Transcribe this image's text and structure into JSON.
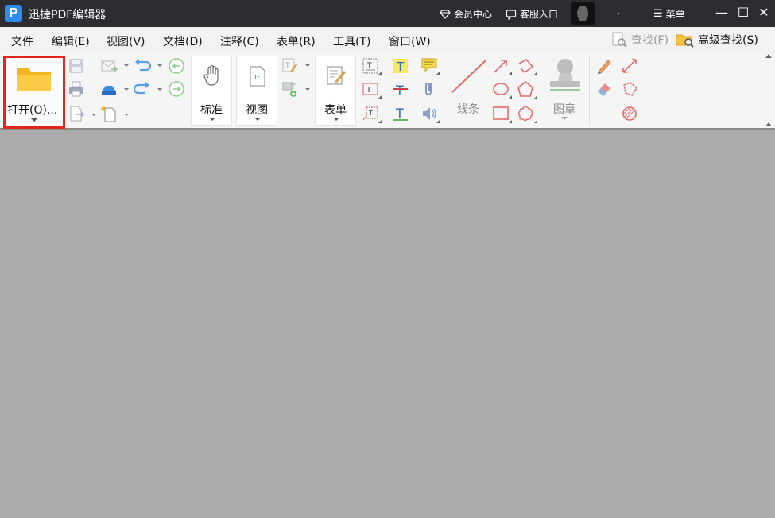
{
  "titlebar": {
    "app_logo": "P",
    "app_title": "迅捷PDF编辑器",
    "vip_label": "会员中心",
    "service_label": "客服入口",
    "dot": ".",
    "menu_label": "菜单"
  },
  "menubar": {
    "items": [
      "文件",
      "编辑(E)",
      "视图(V)",
      "文档(D)",
      "注释(C)",
      "表单(R)",
      "工具(T)",
      "窗口(W)"
    ],
    "find_label": "查找(F)",
    "advanced_find_label": "高级查找(S)"
  },
  "toolbar": {
    "open_label": "打开(O)...",
    "standard_label": "标准",
    "view_label": "视图",
    "form_label": "表单",
    "line_label": "线条",
    "stamp_label": "图章",
    "view_icon_text": "1:1"
  },
  "colors": {
    "titlebar_bg": "#2b2d31",
    "highlight_border": "#e8231e",
    "workspace_bg": "#ababab",
    "shape_red": "#e46a6a"
  }
}
